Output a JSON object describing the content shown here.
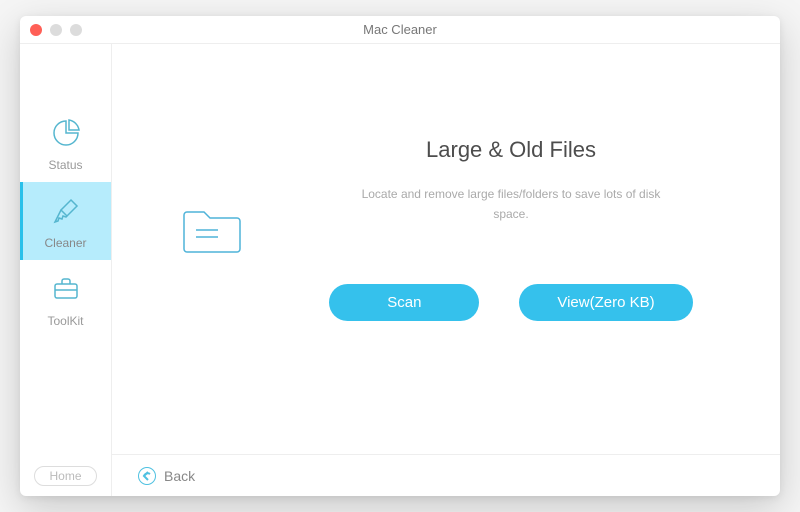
{
  "window": {
    "title": "Mac Cleaner"
  },
  "sidebar": {
    "items": [
      {
        "label": "Status"
      },
      {
        "label": "Cleaner"
      },
      {
        "label": "ToolKit"
      }
    ],
    "home_label": "Home"
  },
  "main": {
    "title": "Large & Old Files",
    "description": "Locate and remove large files/folders to save lots of disk space.",
    "scan_label": "Scan",
    "view_label": "View(Zero KB)"
  },
  "footer": {
    "back_label": "Back"
  }
}
